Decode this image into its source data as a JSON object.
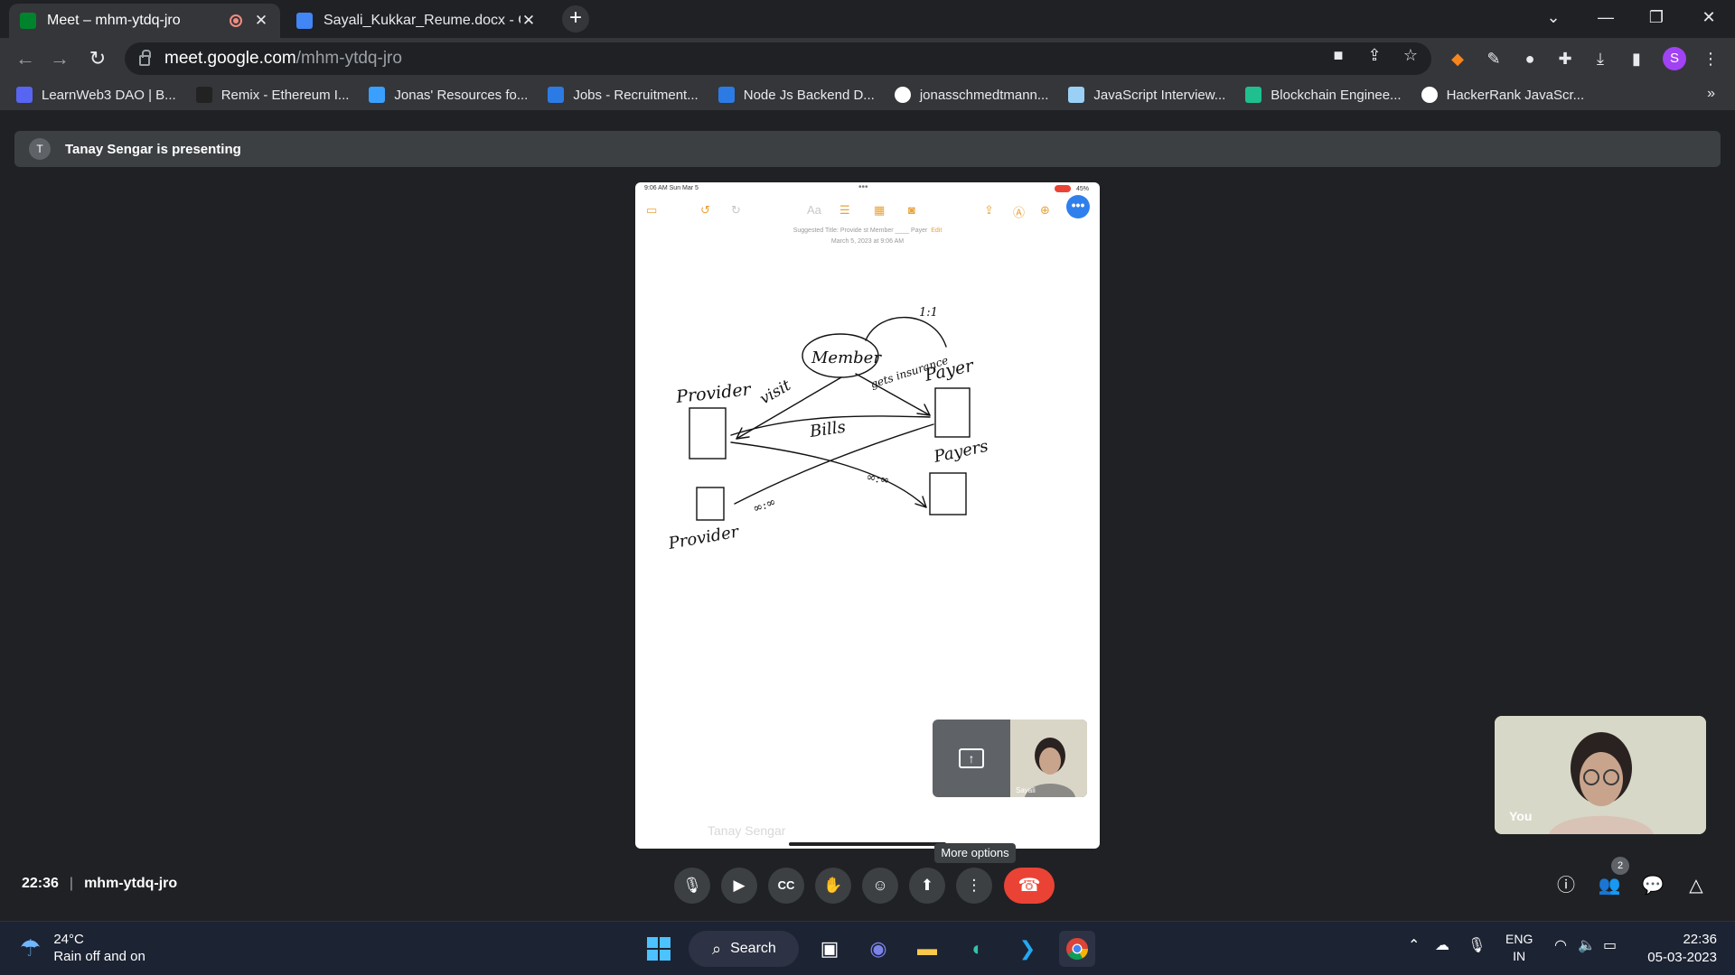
{
  "browser": {
    "tabs": [
      {
        "title": "Meet – mhm-ytdq-jro",
        "active": true
      },
      {
        "title": "Sayali_Kukkar_Reume.docx - Goo",
        "active": false
      }
    ],
    "url_host": "meet.google.com",
    "url_path": "/mhm-ytdq-jro",
    "profile_initial": "S",
    "bookmarks": [
      "LearnWeb3 DAO | B...",
      "Remix - Ethereum I...",
      "Jonas' Resources fo...",
      "Jobs - Recruitment...",
      "Node Js Backend D...",
      "jonasschmedtmann...",
      "JavaScript Interview...",
      "Blockchain Enginee...",
      "HackerRank JavaScr..."
    ]
  },
  "meet": {
    "presenter_initial": "T",
    "presenting_text": "Tanay Sengar is presenting",
    "time": "22:36",
    "meeting_code": "mhm-ytdq-jro",
    "tooltip": "More options",
    "self_label": "You",
    "mini_name": "Sayali",
    "participant_count": "2",
    "shared_screen": {
      "status_time": "9:06 AM  Sun Mar 5",
      "battery": "45%",
      "suggested_title": "Suggested Title: Provide st Member ____ Payer",
      "suggested_edit": "Edit",
      "note_date": "March 5, 2023 at 9:06 AM",
      "watermark": "Tanay Sengar",
      "sketch_words": [
        "Member",
        "Provider",
        "visit",
        "gets insurance",
        "Payer",
        "1:1",
        "Bills",
        "Payers",
        "∞:∞",
        "∞:∞",
        "Provider"
      ]
    }
  },
  "taskbar": {
    "temperature": "24°C",
    "weather_text": "Rain off and on",
    "search_label": "Search",
    "lang": "ENG",
    "region": "IN",
    "clock_time": "22:36",
    "clock_date": "05-03-2023"
  }
}
